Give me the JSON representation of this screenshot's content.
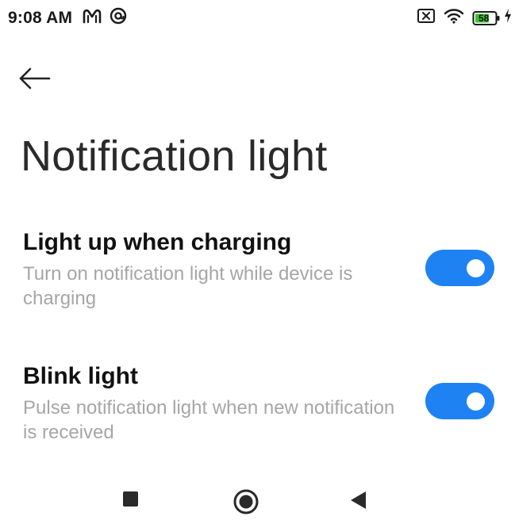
{
  "status_bar": {
    "time": "9:08 AM",
    "left_icons": [
      "m-app-icon",
      "at-sign-icon"
    ],
    "right_icons": [
      "sim-blocked-icon",
      "wifi-icon",
      "battery-icon",
      "charging-bolt-icon"
    ],
    "battery_level": "58",
    "battery_color": "#3fbf2f"
  },
  "header": {
    "back_icon": "back-arrow-icon",
    "title": "Notification light"
  },
  "settings": [
    {
      "title": "Light up when charging",
      "summary": "Turn on notification light while device is charging",
      "enabled": true
    },
    {
      "title": "Blink light",
      "summary": "Pulse notification light when new notification is received",
      "enabled": true
    }
  ],
  "colors": {
    "accent": "#1e82f3",
    "summary_text": "#a6a6a6",
    "title_text": "#2a2a2a"
  },
  "nav_bar": {
    "buttons": [
      "recents-square-icon",
      "home-circle-icon",
      "back-triangle-icon"
    ]
  }
}
